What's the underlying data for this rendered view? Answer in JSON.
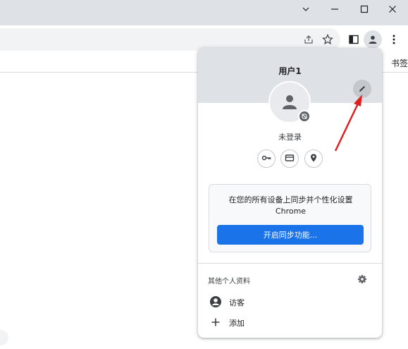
{
  "window_controls": {
    "tab_list_icon": "chevron-down-icon",
    "minimize_icon": "minimize-icon",
    "maximize_icon": "maximize-icon",
    "close_icon": "close-icon"
  },
  "toolbar": {
    "share_icon": "share-icon",
    "bookmark_icon": "star-icon",
    "side_panel_icon": "side-panel-icon",
    "profile_icon": "profile-icon",
    "menu_icon": "more-vert-icon"
  },
  "bookmarks_bar": {
    "visible_fragment": "书签"
  },
  "profile_popup": {
    "title": "用户1",
    "edit_icon": "pencil-icon",
    "sign_in_status": "未登录",
    "quick_actions": [
      "key-icon",
      "credit-card-icon",
      "location-pin-icon"
    ],
    "sync_card": {
      "line1": "在您的所有设备上同步并个性化设置",
      "line2": "Chrome",
      "button_label": "开启同步功能..."
    },
    "other_profiles_label": "其他个人资料",
    "settings_icon": "gear-icon",
    "profiles": [
      {
        "label": "访客",
        "icon": "account-circle-icon"
      },
      {
        "label": "添加",
        "icon": "plus-icon"
      }
    ]
  },
  "annotation": {
    "color": "#e02020",
    "type": "red-arrow"
  },
  "colors": {
    "accent": "#1a73e8",
    "header_bg": "#dee1e6"
  }
}
